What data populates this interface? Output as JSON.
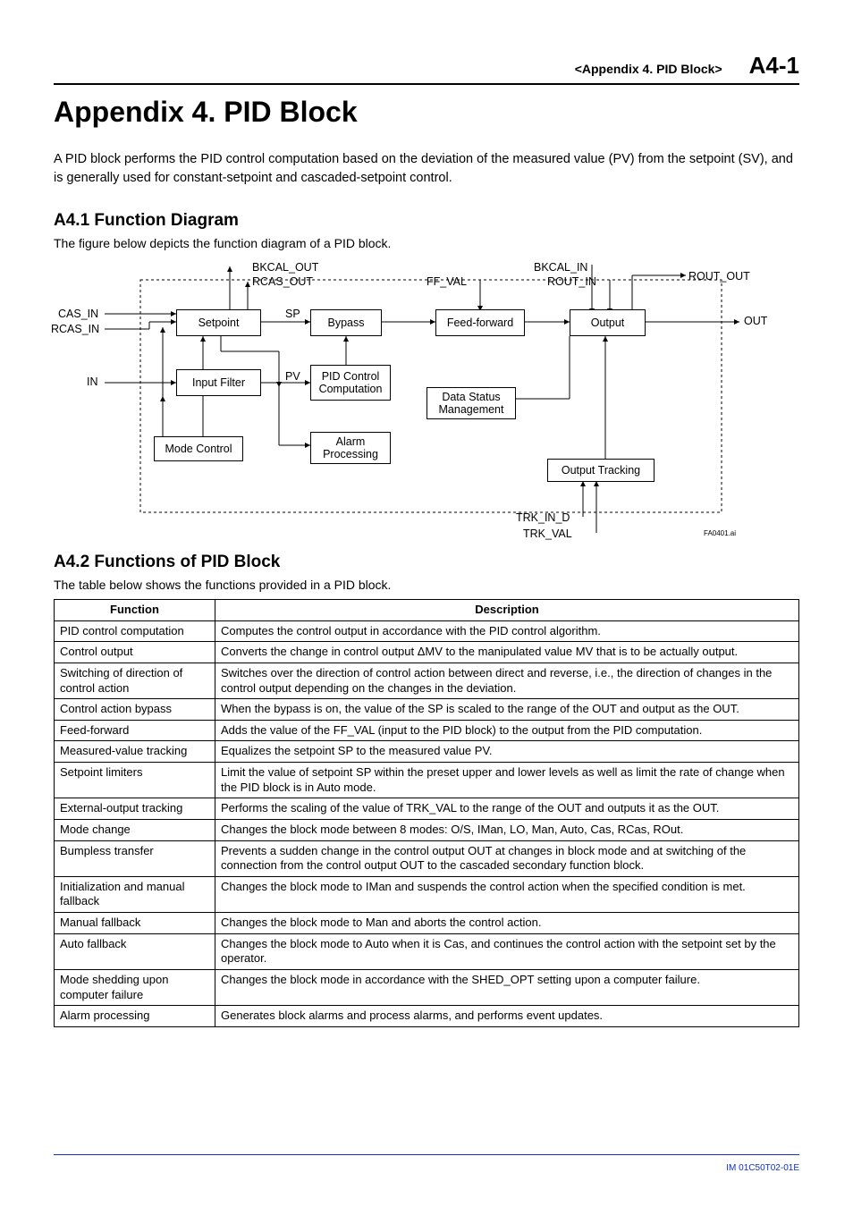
{
  "header": {
    "breadcrumb": "<Appendix 4.  PID Block>",
    "page_number": "A4-1"
  },
  "title": "Appendix 4.  PID Block",
  "intro": "A PID block performs the PID control computation based on the deviation of the measured value (PV) from the setpoint (SV), and is generally used for constant-setpoint and cascaded-setpoint control.",
  "sec1": {
    "heading": "A4.1   Function Diagram",
    "caption": "The figure below depicts the function diagram of a PID block.",
    "fig_ref": "FA0401.ai"
  },
  "diagram": {
    "labels": {
      "bkcal_out": "BKCAL_OUT",
      "rcas_out": "RCAS_OUT",
      "ff_val": "FF_VAL",
      "bkcal_in": "BKCAL_IN",
      "rout_in": "ROUT_IN",
      "rout_out": "ROUT_OUT",
      "cas_in": "CAS_IN",
      "rcas_in": "RCAS_IN",
      "sp": "SP",
      "pv": "PV",
      "in": "IN",
      "out": "OUT",
      "trk_in_d": "TRK_IN_D",
      "trk_val": "TRK_VAL"
    },
    "boxes": {
      "setpoint": "Setpoint",
      "bypass": "Bypass",
      "feed_forward": "Feed-forward",
      "output": "Output",
      "input_filter": "Input Filter",
      "pid_comp": "PID Control\nComputation",
      "data_status": "Data Status\nManagement",
      "mode_control": "Mode Control",
      "alarm_proc": "Alarm\nProcessing",
      "output_tracking": "Output Tracking"
    }
  },
  "sec2": {
    "heading": "A4.2   Functions of PID Block",
    "caption": "The table below shows the functions provided in a PID block.",
    "th_func": "Function",
    "th_desc": "Description",
    "rows": [
      {
        "f": "PID control computation",
        "d": "Computes the control output in accordance with the PID control algorithm."
      },
      {
        "f": "Control output",
        "d": "Converts the change in control output ΔMV to the manipulated value MV that is to be actually output."
      },
      {
        "f": "Switching of direction of control action",
        "d": "Switches over the direction of control action between direct and reverse, i.e., the direction of changes in the control output depending on the changes in the deviation."
      },
      {
        "f": "Control action bypass",
        "d": "When the bypass is on, the value of the SP is scaled to the range of the OUT and output as the OUT."
      },
      {
        "f": "Feed-forward",
        "d": "Adds the value of the FF_VAL (input to the PID block) to the output from the PID computation."
      },
      {
        "f": "Measured-value tracking",
        "d": "Equalizes the setpoint SP to the measured value PV."
      },
      {
        "f": "Setpoint limiters",
        "d": "Limit the value of setpoint SP within the preset upper and lower levels as well as limit the rate of change when the PID block is in Auto mode."
      },
      {
        "f": "External-output tracking",
        "d": "Performs the scaling of the value of TRK_VAL to the range of the OUT and outputs it as the OUT."
      },
      {
        "f": "Mode change",
        "d": "Changes the block mode between 8 modes: O/S, IMan, LO, Man, Auto, Cas, RCas, ROut."
      },
      {
        "f": "Bumpless transfer",
        "d": "Prevents a sudden change in the control output OUT at changes in block mode and at switching of the connection from the control output OUT to the cascaded secondary function block."
      },
      {
        "f": "Initialization and manual fallback",
        "d": "Changes the block mode to IMan and suspends the control action when the specified condition is met."
      },
      {
        "f": "Manual fallback",
        "d": "Changes the block mode to Man and aborts the control action."
      },
      {
        "f": "Auto fallback",
        "d": "Changes the block mode to Auto when it is Cas, and continues the control action with the setpoint set by the operator."
      },
      {
        "f": "Mode shedding upon computer failure",
        "d": "Changes the block mode in accordance with the SHED_OPT setting upon a computer failure."
      },
      {
        "f": "Alarm processing",
        "d": "Generates block alarms and process alarms, and performs event updates."
      }
    ]
  },
  "footer": "IM 01C50T02-01E"
}
